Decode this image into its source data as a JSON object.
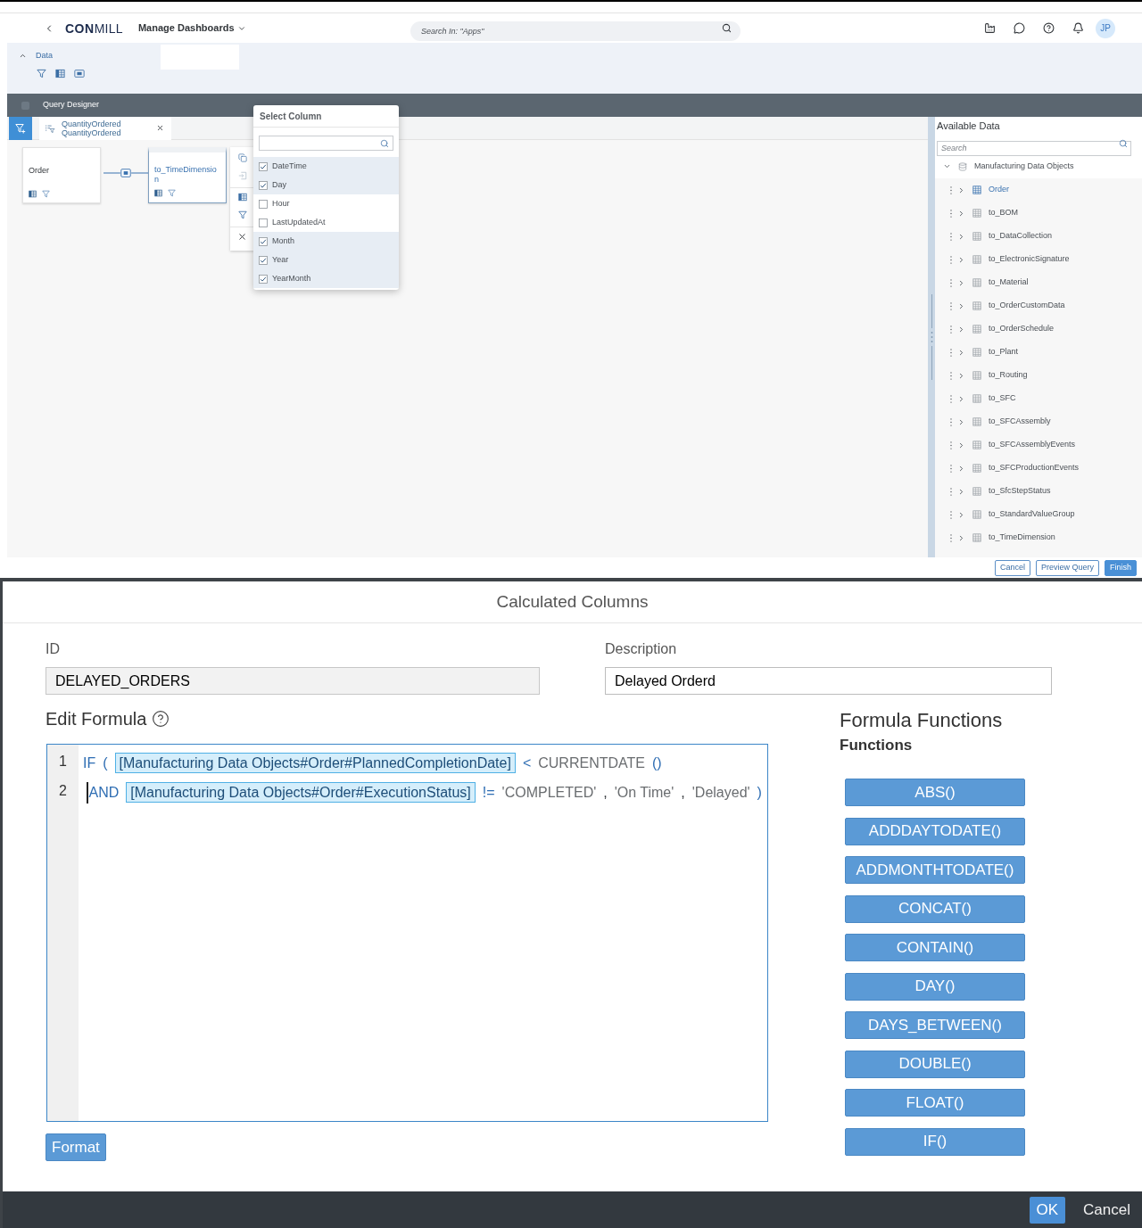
{
  "header": {
    "logo": {
      "bold": "CON",
      "light": "MILL"
    },
    "app_title": "Manage Dashboards",
    "search": {
      "placeholder": "Search In: \"Apps\""
    },
    "avatar": "JP"
  },
  "data_section": {
    "label": "Data",
    "expanded": true
  },
  "query_designer": {
    "title": "Query Designer",
    "filter_chip": {
      "title": "QuantityOrdered",
      "subtitle": "QuantityOrdered"
    },
    "nodes": [
      {
        "label": "Order",
        "selected": false
      },
      {
        "label": "to_TimeDimension",
        "selected": true
      }
    ],
    "node_toolbar": [
      {
        "kind": "copy",
        "disabled": false
      },
      {
        "kind": "insert",
        "disabled": true
      },
      {
        "kind": "columns",
        "disabled": false
      },
      {
        "kind": "filter",
        "disabled": false
      },
      {
        "kind": "delete",
        "disabled": false
      }
    ]
  },
  "select_column": {
    "title": "Select Column",
    "options": [
      {
        "label": "DateTime",
        "checked": true
      },
      {
        "label": "Day",
        "checked": true
      },
      {
        "label": "Hour",
        "checked": false
      },
      {
        "label": "LastUpdatedAt",
        "checked": false
      },
      {
        "label": "Month",
        "checked": true
      },
      {
        "label": "Year",
        "checked": true
      },
      {
        "label": "YearMonth",
        "checked": true
      }
    ]
  },
  "available_data": {
    "title": "Available Data",
    "search": {
      "placeholder": "Search"
    },
    "tree": {
      "label": "Manufacturing Data Objects",
      "expanded": true,
      "children": [
        {
          "label": "Order",
          "selected": true,
          "expanded": false
        },
        {
          "label": "to_BOM",
          "selected": false,
          "expanded": false
        },
        {
          "label": "to_DataCollection",
          "selected": false,
          "expanded": false
        },
        {
          "label": "to_ElectronicSignature",
          "selected": false,
          "expanded": false
        },
        {
          "label": "to_Material",
          "selected": false,
          "expanded": false
        },
        {
          "label": "to_OrderCustomData",
          "selected": false,
          "expanded": false
        },
        {
          "label": "to_OrderSchedule",
          "selected": false,
          "expanded": false
        },
        {
          "label": "to_Plant",
          "selected": false,
          "expanded": false
        },
        {
          "label": "to_Routing",
          "selected": false,
          "expanded": false
        },
        {
          "label": "to_SFC",
          "selected": false,
          "expanded": false
        },
        {
          "label": "to_SFCAssembly",
          "selected": false,
          "expanded": false
        },
        {
          "label": "to_SFCAssemblyEvents",
          "selected": false,
          "expanded": false
        },
        {
          "label": "to_SFCProductionEvents",
          "selected": false,
          "expanded": false
        },
        {
          "label": "to_SfcStepStatus",
          "selected": false,
          "expanded": false
        },
        {
          "label": "to_StandardValueGroup",
          "selected": false,
          "expanded": false
        },
        {
          "label": "to_TimeDimension",
          "selected": false,
          "expanded": false
        }
      ]
    }
  },
  "query_buttons": [
    {
      "label": "Cancel",
      "kind": "secondary"
    },
    {
      "label": "Preview Query",
      "kind": "secondary"
    },
    {
      "label": "Finish",
      "kind": "primary"
    }
  ],
  "dialog": {
    "title": "Calculated Columns",
    "id_field": {
      "label": "ID",
      "value": "DELAYED_ORDERS",
      "disabled": true
    },
    "description_field": {
      "label": "Description",
      "value": "Delayed Orderd",
      "disabled": false
    },
    "edit_formula": {
      "title": "Edit Formula",
      "lines": [
        {
          "number": "1",
          "cursor": false,
          "tokens": [
            {
              "kind": "keyword",
              "text": "IF"
            },
            {
              "kind": "operator",
              "text": "("
            },
            {
              "kind": "field",
              "text": "[Manufacturing Data Objects#Order#PlannedCompletionDate]"
            },
            {
              "kind": "operator",
              "text": "<"
            },
            {
              "kind": "function",
              "text": "CURRENTDATE"
            },
            {
              "kind": "operator",
              "text": "()"
            }
          ]
        },
        {
          "number": "2",
          "cursor": true,
          "tokens": [
            {
              "kind": "keyword",
              "text": "AND"
            },
            {
              "kind": "field",
              "text": "[Manufacturing Data Objects#Order#ExecutionStatus]"
            },
            {
              "kind": "operator",
              "text": "!="
            },
            {
              "kind": "string",
              "text": "'COMPLETED'"
            },
            {
              "kind": "separator",
              "text": ","
            },
            {
              "kind": "string",
              "text": "'On Time'"
            },
            {
              "kind": "separator",
              "text": ","
            },
            {
              "kind": "string",
              "text": "'Delayed'"
            },
            {
              "kind": "operator",
              "text": ")"
            }
          ]
        }
      ],
      "format_button": "Format"
    },
    "functions_panel": {
      "title": "Formula Functions",
      "subtitle": "Functions",
      "functions": [
        "ABS()",
        "ADDDAYTODATE()",
        "ADDMONTHTODATE()",
        "CONCAT()",
        "CONTAIN()",
        "DAY()",
        "DAYS_BETWEEN()",
        "DOUBLE()",
        "FLOAT()",
        "IF()"
      ]
    },
    "buttons": [
      {
        "label": "OK",
        "kind": "primary"
      },
      {
        "label": "Cancel",
        "kind": "secondary"
      }
    ]
  }
}
